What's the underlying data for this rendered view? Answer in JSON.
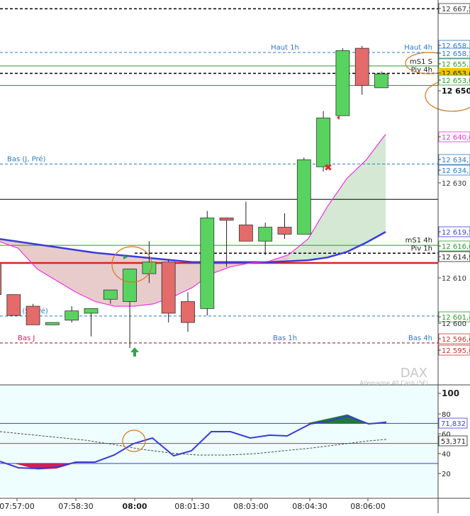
{
  "colors": {
    "background": "#ffffff",
    "panel_bg": "#eefdfd",
    "bull_candle": "#59d35f",
    "bear_candle": "#e56a6a",
    "candle_outline": "#333333",
    "wick": "#222222",
    "ma_blue": "#3b3bdb",
    "ma_pink": "#ee2ee8",
    "level_red": "#e02020",
    "level_green": "#2a9a2a",
    "level_blue_dash": "#2a78c8",
    "level_red_dash": "#d03030",
    "level_black": "#000000",
    "highlight_circle": "#d4761f",
    "fill_bear_area": "#e8cccc",
    "fill_bull_area": "#d4e8d4",
    "osc_line": "#3a3ad8",
    "osc_green_fill": "#1f7a3a",
    "osc_red_fill": "#cc2255",
    "current_price_bg": "#f4c400"
  },
  "chart_data": [
    {
      "type": "candlestick",
      "instrument": "DAX",
      "instrument_subtitle": "Allemagne 40 Cash (5€)",
      "ylim": [
        12590.5,
        12668.5
      ],
      "time_labels": [
        "07:57:00",
        "07:58:30",
        "08:00",
        "08:01:30",
        "08:03:00",
        "08:04:30",
        "08:06:00"
      ],
      "price_tick_labels": [
        "12 667,5",
        "12 658,1",
        "12 658,1",
        "12 655,2",
        "12 653,6",
        "12 653,0",
        "12 650",
        "12 640,0",
        "12 634,1",
        "12 634,1",
        "12 630",
        "12 619,5",
        "12 616,6",
        "12 614,9",
        "12 610",
        "12 601,4",
        "12 600",
        "12 596,6",
        "12 595,6"
      ],
      "current_price_label": "12 653,6",
      "candles": [
        {
          "o": 12612.5,
          "h": 12612.5,
          "l": 12606.0,
          "c": 12606.0
        },
        {
          "o": 12606.0,
          "h": 12606.0,
          "l": 12601.5,
          "c": 12601.5
        },
        {
          "o": 12603.5,
          "h": 12604.0,
          "l": 12599.5,
          "c": 12599.5
        },
        {
          "o": 12599.5,
          "h": 12600.0,
          "l": 12599.5,
          "c": 12600.0
        },
        {
          "o": 12600.5,
          "h": 12603.5,
          "l": 12600.0,
          "c": 12602.5
        },
        {
          "o": 12602.0,
          "h": 12603.0,
          "l": 12597.0,
          "c": 12603.0
        },
        {
          "o": 12605.0,
          "h": 12607.0,
          "l": 12604.0,
          "c": 12607.0
        },
        {
          "o": 12604.5,
          "h": 12611.5,
          "l": 12594.5,
          "c": 12611.5
        },
        {
          "o": 12610.5,
          "h": 12617.5,
          "l": 12608.5,
          "c": 12613.0
        },
        {
          "o": 12613.0,
          "h": 12613.5,
          "l": 12600.0,
          "c": 12602.0
        },
        {
          "o": 12604.5,
          "h": 12606.5,
          "l": 12598.0,
          "c": 12600.0
        },
        {
          "o": 12603.0,
          "h": 12624.0,
          "l": 12601.5,
          "c": 12622.5
        },
        {
          "o": 12622.5,
          "h": 12622.5,
          "l": 12612.0,
          "c": 12622.0
        },
        {
          "o": 12621.0,
          "h": 12626.0,
          "l": 12617.5,
          "c": 12617.5
        },
        {
          "o": 12617.5,
          "h": 12621.5,
          "l": 12614.5,
          "c": 12620.5
        },
        {
          "o": 12620.5,
          "h": 12623.5,
          "l": 12618.0,
          "c": 12619.0
        },
        {
          "o": 12619.0,
          "h": 12635.5,
          "l": 12619.0,
          "c": 12635.0
        },
        {
          "o": 12633.5,
          "h": 12645.5,
          "l": 12632.5,
          "c": 12644.0
        },
        {
          "o": 12644.5,
          "h": 12659.0,
          "l": 12644.5,
          "c": 12658.5
        },
        {
          "o": 12659.0,
          "h": 12659.5,
          "l": 12649.0,
          "c": 12651.0
        },
        {
          "o": 12650.5,
          "h": 12654.0,
          "l": 12650.5,
          "c": 12653.5
        }
      ],
      "ma_blue": [
        12618.0,
        12617.4,
        12616.8,
        12616.2,
        12615.6,
        12615.0,
        12614.6,
        12614.2,
        12613.8,
        12613.4,
        12613.0,
        12613.0,
        12613.0,
        12613.0,
        12613.0,
        12613.2,
        12613.4,
        12614.0,
        12615.2,
        12617.2,
        12619.5
      ],
      "ma_pink": [
        12617.5,
        12616.0,
        12611.5,
        12609.0,
        12606.5,
        12604.5,
        12603.5,
        12603.5,
        12604.0,
        12605.5,
        12607.5,
        12610.5,
        12612.0,
        12612.8,
        12613.2,
        12614.6,
        12618.0,
        12625.0,
        12631.0,
        12635.0,
        12640.5
      ],
      "levels": [
        {
          "name": "level-haut-4h",
          "value": 12658.1,
          "label": "Haut 4h",
          "style": "dash-blue",
          "label_side": "right"
        },
        {
          "name": "level-haut-1h",
          "value": 12658.1,
          "label": "Haut 1h",
          "style": "dash-blue",
          "label_side": "center"
        },
        {
          "name": "level-ms1-s",
          "value": 12655.2,
          "label": "mS1 S",
          "style": "solid-green",
          "label_side": "right"
        },
        {
          "name": "level-piv-4h",
          "value": 12653.6,
          "label": "Piv 4h",
          "style": "dash-black",
          "label_side": "right"
        },
        {
          "name": "level-651",
          "value": 12651.0,
          "label": "",
          "style": "solid-green",
          "label_side": "none"
        },
        {
          "name": "level-bas-j-pre",
          "value": 12634.1,
          "label": "Bas (J, Pré)",
          "style": "dash-blue",
          "label_side": "left"
        },
        {
          "name": "level-black-626",
          "value": 12626.5,
          "label": "",
          "style": "solid-black",
          "label_side": "none"
        },
        {
          "name": "level-ms1-4h",
          "value": 12616.6,
          "label": "mS1 4h",
          "style": "solid-green",
          "label_side": "right"
        },
        {
          "name": "level-piv-1h",
          "value": 12614.9,
          "label": "Piv 1h",
          "style": "dash-black",
          "label_side": "right"
        },
        {
          "name": "level-red-613",
          "value": 12612.8,
          "label": "",
          "style": "solid-red",
          "label_side": "none"
        },
        {
          "name": "level-bas-s-pre",
          "value": 12601.4,
          "label": "Bas (S, Pré)",
          "style": "dash-blue",
          "label_side": "left"
        },
        {
          "name": "level-bas-1h",
          "value": 12595.6,
          "label": "Bas 1h",
          "style": "dash-blue",
          "label_side": "center"
        },
        {
          "name": "level-bas-4h",
          "value": 12595.6,
          "label": "Bas 4h",
          "style": "dash-blue",
          "label_side": "right"
        },
        {
          "name": "level-bas-j",
          "value": 12595.6,
          "label": "Bas J",
          "style": "dash-red",
          "label_side": "left"
        },
        {
          "name": "level-top-667",
          "value": 12667.5,
          "label": "",
          "style": "dash-black",
          "label_side": "none"
        }
      ]
    },
    {
      "type": "line",
      "name": "oscillator",
      "ylim": [
        0,
        112
      ],
      "tick_labels": [
        "100",
        "80",
        "60",
        "40",
        "20"
      ],
      "tick_values": [
        100,
        80,
        60,
        40,
        20
      ],
      "value_labels": [
        "71,832",
        "53,371"
      ],
      "upper_band": 70,
      "lower_band": 30,
      "mid_band": 50,
      "osc_values": [
        30,
        27,
        24,
        25,
        30,
        30,
        37,
        50,
        54,
        57,
        40,
        43,
        63,
        63,
        57,
        60,
        59,
        70,
        73,
        79,
        70,
        72
      ],
      "signal_values": [
        62,
        61,
        59,
        57,
        54,
        50,
        46,
        43,
        41,
        39,
        37,
        36,
        36,
        36.5,
        37.5,
        39,
        40.5,
        42.5,
        45,
        47.5,
        50.5,
        53.4
      ]
    }
  ]
}
